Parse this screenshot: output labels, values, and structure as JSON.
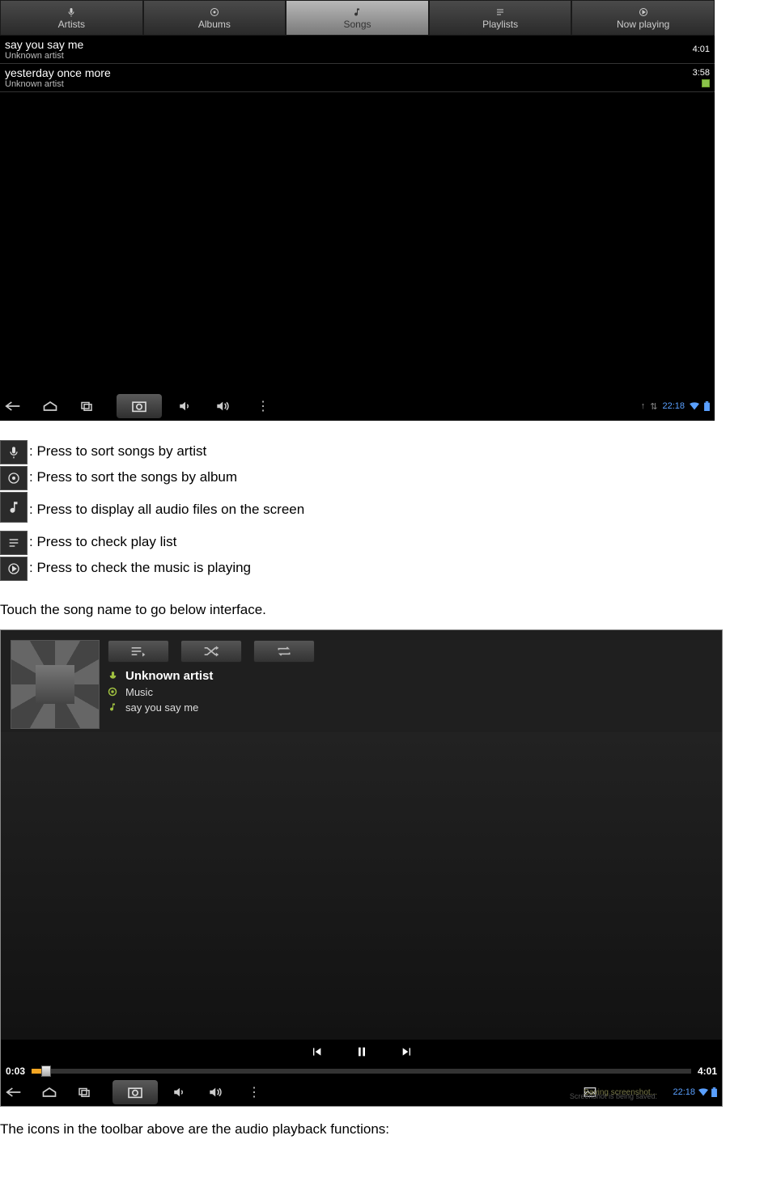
{
  "screenshot1": {
    "tabs": [
      {
        "label": "Artists",
        "icon": "mic-icon"
      },
      {
        "label": "Albums",
        "icon": "disc-icon"
      },
      {
        "label": "Songs",
        "icon": "note-icon",
        "active": true
      },
      {
        "label": "Playlists",
        "icon": "list-icon"
      },
      {
        "label": "Now playing",
        "icon": "play-icon"
      }
    ],
    "songs": [
      {
        "title": "say you say me",
        "artist": "Unknown artist",
        "duration": "4:01"
      },
      {
        "title": "yesterday once more",
        "artist": "Unknown artist",
        "duration": "3:58",
        "playing": true
      }
    ],
    "status_time": "22:18"
  },
  "legend": [
    {
      "icon": "mic-icon",
      "text": ": Press to sort songs by artist"
    },
    {
      "icon": "disc-icon",
      "text": ": Press to sort the songs by album"
    },
    {
      "icon": "note-icon",
      "text": ": Press to display all audio files on the screen",
      "big": true
    },
    {
      "icon": "list-icon",
      "text": ": Press to check play list"
    },
    {
      "icon": "play-icon",
      "text": ": Press to check the music is playing"
    }
  ],
  "body1": "Touch the song name to go below interface.",
  "screenshot2": {
    "meta": {
      "artist": "Unknown artist",
      "album": "Music",
      "title": "say you say me"
    },
    "progress": {
      "elapsed": "0:03",
      "total": "4:01"
    },
    "toast1": "Saving screenshot...",
    "toast2": "Screenshot is being saved.",
    "status_time": "22:18"
  },
  "body2": "The icons in the toolbar above are the audio playback functions:"
}
